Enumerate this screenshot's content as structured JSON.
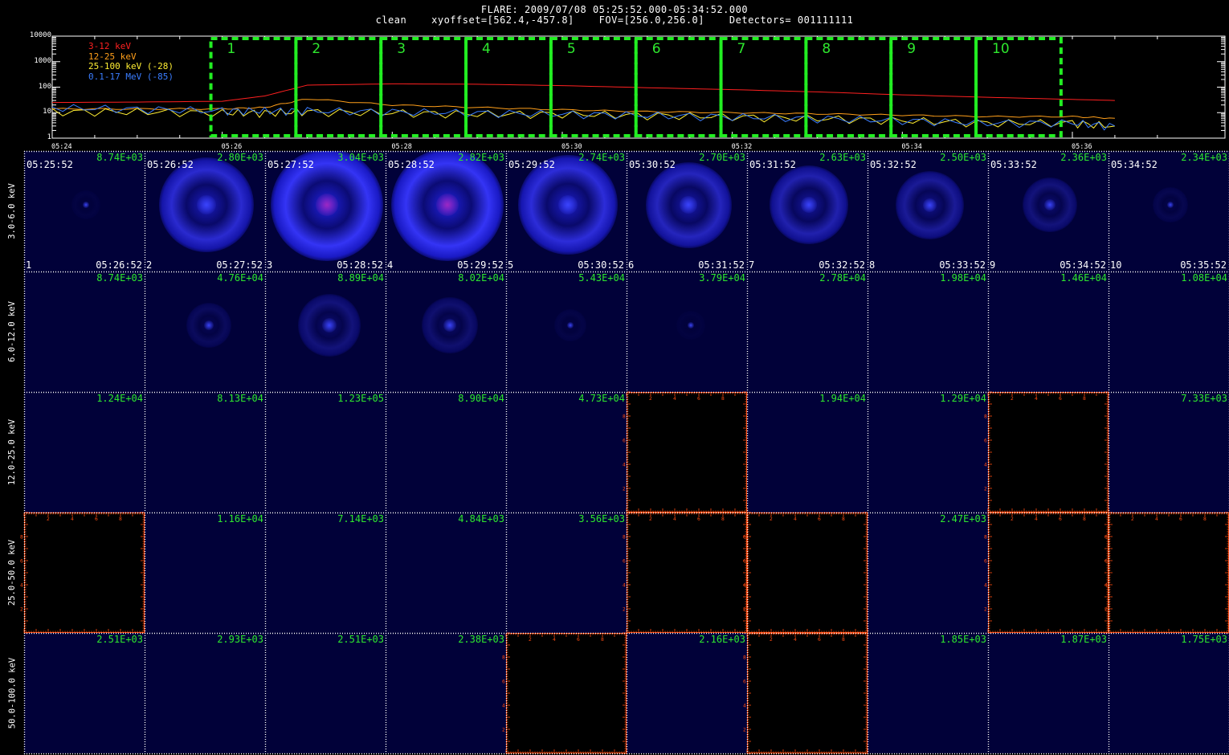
{
  "header": {
    "line1": "FLARE: 2009/07/08 05:25:52.000-05:34:52.000",
    "line2": "clean    xyoffset=[562.4,-457.8]    FOV=[256.0,256.0]    Detectors= 001111111"
  },
  "lightcurve": {
    "type": "line",
    "scale": "log",
    "ylim": [
      1,
      10000
    ],
    "ytick_labels": [
      "10000",
      "1000",
      "100",
      "10",
      "1"
    ],
    "xtick_labels": [
      "05:24",
      "05:26",
      "05:28",
      "05:30",
      "05:32",
      "05:34",
      "05:36"
    ],
    "legend": [
      {
        "label": "3-12 keV",
        "color": "#ff2020"
      },
      {
        "label": "12-25 keV",
        "color": "#ff9f1a"
      },
      {
        "label": "25-100 keV (-28)",
        "color": "#ffee33"
      },
      {
        "label": "0.1-17 MeV (-85)",
        "color": "#3a7dff"
      }
    ],
    "interval_color": "#22ee22",
    "intervals": [
      "1",
      "2",
      "3",
      "4",
      "5",
      "6",
      "7",
      "8",
      "9",
      "10"
    ]
  },
  "chart_data": {
    "type": "line",
    "x_range": [
      "05:24",
      "05:36"
    ],
    "y_scale": "log",
    "ylim": [
      1,
      10000
    ],
    "x": [
      "05:24",
      "05:25",
      "05:26",
      "05:26:30",
      "05:27",
      "05:28",
      "05:29",
      "05:30",
      "05:31",
      "05:32",
      "05:33",
      "05:34",
      "05:35",
      "05:36",
      "05:36:30"
    ],
    "series": [
      {
        "name": "3-12 keV",
        "color": "#ff2020",
        "values": [
          25,
          26,
          28,
          45,
          120,
          135,
          130,
          115,
          95,
          80,
          65,
          50,
          40,
          33,
          30
        ]
      },
      {
        "name": "12-25 keV",
        "color": "#ff9f1a",
        "values": [
          14,
          14,
          14,
          16,
          35,
          20,
          16,
          13,
          11,
          10,
          9,
          8,
          7,
          7,
          6
        ]
      },
      {
        "name": "25-100 keV (-28)",
        "color": "#ffee33",
        "values": [
          11,
          11,
          10,
          10,
          11,
          10,
          9,
          9,
          8,
          7,
          6,
          5,
          4,
          4,
          3
        ]
      },
      {
        "name": "0.1-17 MeV (-85)",
        "color": "#3a7dff",
        "values": [
          16,
          14,
          12,
          12,
          12,
          11,
          10,
          9,
          8,
          7,
          6,
          5,
          4,
          4,
          3
        ]
      }
    ]
  },
  "bands": [
    "3.0-6.0 keV",
    "6.0-12.0 keV",
    "12.0-25.0 keV",
    "25.0-50.0 keV",
    "50.0-100.0 keV"
  ],
  "time_starts": [
    "05:25:52",
    "05:26:52",
    "05:27:52",
    "05:28:52",
    "05:29:52",
    "05:30:52",
    "05:31:52",
    "05:32:52",
    "05:33:52",
    "05:34:52"
  ],
  "time_ends": [
    "05:26:52",
    "05:27:52",
    "05:28:52",
    "05:29:52",
    "05:30:52",
    "05:31:52",
    "05:32:52",
    "05:33:52",
    "05:34:52",
    "05:35:52"
  ],
  "indices": [
    "1",
    "2",
    "3",
    "4",
    "5",
    "6",
    "7",
    "8",
    "9",
    "10"
  ],
  "maxima": [
    [
      "8.74E+03",
      "2.80E+03",
      "3.04E+03",
      "2.82E+03",
      "2.74E+03",
      "2.70E+03",
      "2.63E+03",
      "2.50E+03",
      "2.36E+03",
      "2.34E+03"
    ],
    [
      "8.74E+03",
      "4.76E+04",
      "8.89E+04",
      "8.02E+04",
      "5.43E+04",
      "3.79E+04",
      "2.78E+04",
      "1.98E+04",
      "1.46E+04",
      "1.08E+04"
    ],
    [
      "1.24E+04",
      "8.13E+04",
      "1.23E+05",
      "8.90E+04",
      "4.73E+04",
      "",
      "1.94E+04",
      "1.29E+04",
      "",
      "7.33E+03"
    ],
    [
      "",
      "1.16E+04",
      "7.14E+03",
      "4.84E+03",
      "3.56E+03",
      "",
      "",
      "2.47E+03",
      "",
      ""
    ],
    [
      "2.51E+03",
      "2.93E+03",
      "2.51E+03",
      "2.38E+03",
      "",
      "2.16E+03",
      "",
      "1.85E+03",
      "1.87E+03",
      "1.75E+03"
    ]
  ],
  "cell_state": [
    [
      "img",
      "img",
      "img",
      "img",
      "img",
      "img",
      "img",
      "img",
      "img",
      "img"
    ],
    [
      "img",
      "img",
      "img",
      "img",
      "img",
      "img",
      "img",
      "img",
      "img",
      "img"
    ],
    [
      "img",
      "img",
      "img",
      "img",
      "img",
      "blank",
      "img",
      "img",
      "blank",
      "img"
    ],
    [
      "blank",
      "img",
      "img",
      "img",
      "img",
      "blank",
      "blank",
      "img",
      "blank",
      "blank"
    ],
    [
      "img",
      "img",
      "img",
      "img",
      "blank",
      "img",
      "blank",
      "img",
      "img",
      "img"
    ]
  ],
  "source_intensity": [
    [
      0.05,
      0.8,
      1.0,
      1.0,
      0.85,
      0.7,
      0.62,
      0.5,
      0.35,
      0.12
    ],
    [
      0.0,
      0.3,
      0.55,
      0.45,
      0.12,
      0.06,
      0.0,
      0.0,
      0.0,
      0.0
    ],
    [
      0,
      0,
      0,
      0,
      0,
      0,
      0,
      0,
      0,
      0
    ],
    [
      0,
      0,
      0,
      0,
      0,
      0,
      0,
      0,
      0,
      0
    ],
    [
      0,
      0,
      0,
      0,
      0,
      0,
      0,
      0,
      0,
      0
    ]
  ],
  "blank_axis_color": "#ff4a10",
  "blank_axis_ticks": [
    "2",
    "4",
    "6",
    "8"
  ]
}
